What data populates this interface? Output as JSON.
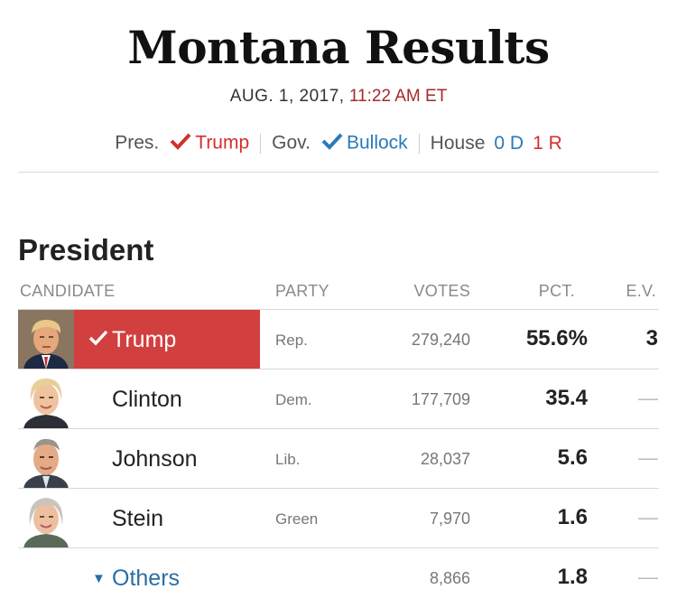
{
  "header": {
    "title": "Montana Results",
    "date": "AUG. 1, 2017,",
    "time": "11:22 AM ET"
  },
  "summary": {
    "pres_label": "Pres.",
    "pres_winner": "Trump",
    "gov_label": "Gov.",
    "gov_winner": "Bullock",
    "house_label": "House",
    "house_dem": "0 D",
    "house_rep": "1 R"
  },
  "section": {
    "title": "President",
    "columns": {
      "candidate": "CANDIDATE",
      "party": "PARTY",
      "votes": "VOTES",
      "pct": "PCT.",
      "ev": "E.V."
    }
  },
  "candidates": [
    {
      "name": "Trump",
      "party": "Rep.",
      "votes": "279,240",
      "pct": "55.6%",
      "ev": "3",
      "winner": true
    },
    {
      "name": "Clinton",
      "party": "Dem.",
      "votes": "177,709",
      "pct": "35.4",
      "ev": "—"
    },
    {
      "name": "Johnson",
      "party": "Lib.",
      "votes": "28,037",
      "pct": "5.6",
      "ev": "—"
    },
    {
      "name": "Stein",
      "party": "Green",
      "votes": "7,970",
      "pct": "1.6",
      "ev": "—"
    }
  ],
  "others": {
    "name": "Others",
    "votes": "8,866",
    "pct": "1.8",
    "ev": "—"
  },
  "colors": {
    "winner_fill": "#d13f3f",
    "republican": "#d0312d",
    "democrat": "#2a7ab8",
    "time": "#a52a2a",
    "link": "#2a6ea6"
  }
}
